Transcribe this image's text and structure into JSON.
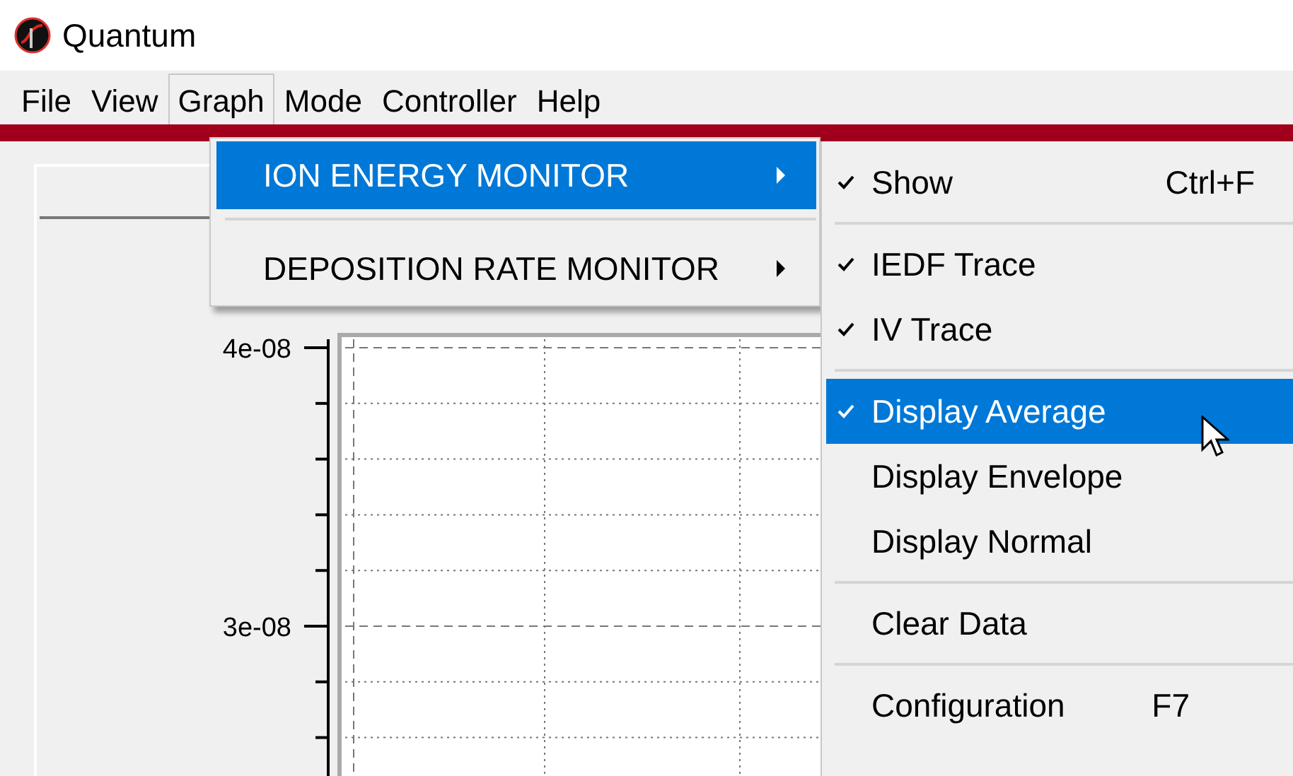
{
  "window": {
    "title": "Quantum"
  },
  "menu_bar": [
    {
      "label": "File",
      "selected": false
    },
    {
      "label": "View",
      "selected": false
    },
    {
      "label": "Graph",
      "selected": true
    },
    {
      "label": "Mode",
      "selected": false
    },
    {
      "label": "Controller",
      "selected": false
    },
    {
      "label": "Help",
      "selected": false
    }
  ],
  "graph_menu": [
    {
      "kind": "item",
      "label": "ION ENERGY MONITOR",
      "selected": true
    },
    {
      "kind": "separator"
    },
    {
      "kind": "item",
      "label": "DEPOSITION RATE MONITOR",
      "selected": false
    }
  ],
  "ion_energy_submenu": [
    {
      "kind": "item",
      "label": "Show",
      "shortcut": "Ctrl+F",
      "checked": true,
      "selected": false
    },
    {
      "kind": "separator"
    },
    {
      "kind": "item",
      "label": "IEDF Trace",
      "checked": true,
      "selected": false
    },
    {
      "kind": "item",
      "label": "IV Trace",
      "checked": true,
      "selected": false
    },
    {
      "kind": "separator"
    },
    {
      "kind": "item",
      "label": "Display Average",
      "checked": true,
      "selected": true
    },
    {
      "kind": "item",
      "label": "Display Envelope",
      "checked": false,
      "selected": false
    },
    {
      "kind": "item",
      "label": "Display Normal",
      "checked": false,
      "selected": false
    },
    {
      "kind": "separator"
    },
    {
      "kind": "item",
      "label": "Clear Data",
      "checked": false,
      "selected": false
    },
    {
      "kind": "separator"
    },
    {
      "kind": "item",
      "label": "Configuration",
      "shortcut": "F7",
      "checked": false,
      "selected": false
    }
  ],
  "graph": {
    "y_tick_labels": [
      "4e-08",
      "3e-08"
    ]
  }
}
